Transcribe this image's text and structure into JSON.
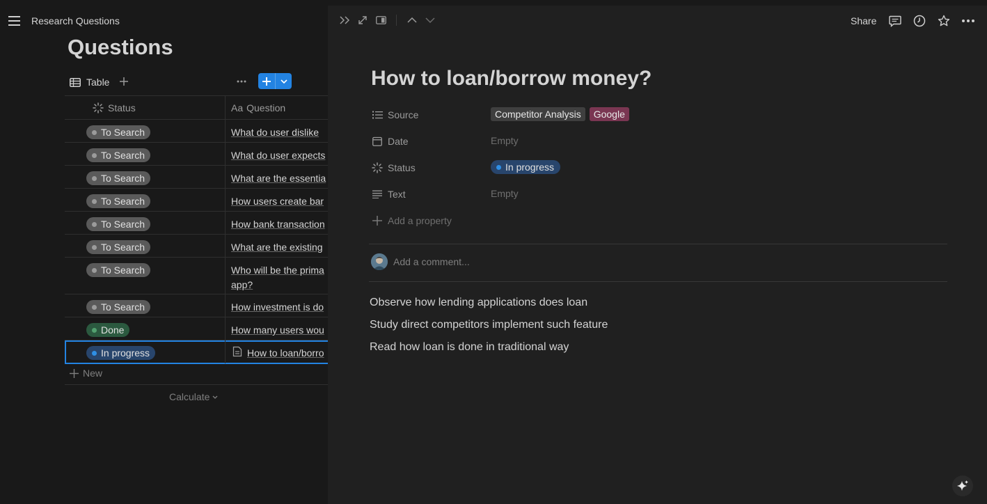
{
  "app": {
    "breadcrumb": "Research Questions",
    "page_title": "Questions"
  },
  "database": {
    "view_tab": "Table",
    "columns": [
      "Status",
      "Question"
    ],
    "rows": [
      {
        "status": "To Search",
        "question": "What do user dislike"
      },
      {
        "status": "To Search",
        "question": "What do user expects"
      },
      {
        "status": "To Search",
        "question": "What are the essentia"
      },
      {
        "status": "To Search",
        "question": "How users create bar"
      },
      {
        "status": "To Search",
        "question": "How bank transaction"
      },
      {
        "status": "To Search",
        "question": "What are the existing"
      },
      {
        "status": "To Search",
        "question": "Who will be the prima app?"
      },
      {
        "status": "To Search",
        "question": "How investment is do"
      },
      {
        "status": "Done",
        "question": "How many users wou"
      },
      {
        "status": "In progress",
        "question": "How to loan/borro"
      }
    ],
    "new_row_label": "New",
    "calculate_label": "Calculate"
  },
  "peek": {
    "toolbar": {
      "share_label": "Share"
    },
    "title": "How to loan/borrow money?",
    "properties": {
      "source_label": "Source",
      "source_values": [
        "Competitor Analysis",
        "Google"
      ],
      "date_label": "Date",
      "date_value": "Empty",
      "status_label": "Status",
      "status_value": "In progress",
      "text_label": "Text",
      "text_value": "Empty",
      "add_property": "Add a property"
    },
    "comment_placeholder": "Add a comment...",
    "body": [
      "Observe how lending applications does loan",
      "Study direct competitors implement such feature",
      "Read how loan is done in traditional way"
    ]
  },
  "colors": {
    "accent": "#2383e2",
    "tag_to_search": "#5a5a5a",
    "tag_done": "#2b593f",
    "tag_in_progress": "#28456c",
    "pill_competitor": "#3f3f3f",
    "pill_google": "#7a3652"
  },
  "icons": [
    "menu-icon",
    "table-icon",
    "plus-icon",
    "more-icon",
    "chevron-down-icon",
    "status-icon",
    "text-type-icon",
    "page-icon",
    "double-chevron-right-icon",
    "expand-icon",
    "side-peek-icon",
    "arrow-up-icon",
    "arrow-down-icon",
    "comment-icon",
    "clock-icon",
    "star-icon",
    "list-icon",
    "calendar-icon",
    "lines-icon",
    "sparkle-icon"
  ]
}
